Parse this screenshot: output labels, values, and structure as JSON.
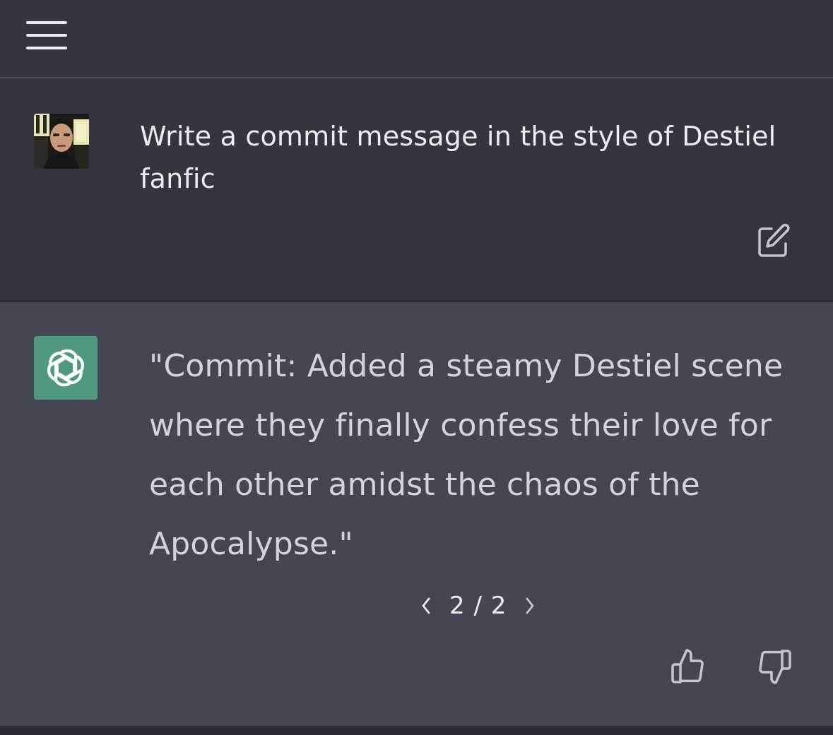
{
  "header": {
    "menu_icon": "hamburger-menu-icon"
  },
  "conversation": {
    "user_message": {
      "avatar": "user-avatar-photo",
      "text": "Write a commit message in the style of Destiel fanfic",
      "edit_icon": "edit-icon"
    },
    "assistant_message": {
      "avatar": "openai-logo-icon",
      "avatar_color": "#4f9a7e",
      "text": "\"Commit: Added a steamy Destiel scene where they finally confess their love for each other amidst the chaos of the Apocalypse.\"",
      "pager": {
        "prev_icon": "chevron-left-icon",
        "label": "2 / 2",
        "next_icon": "chevron-right-icon"
      },
      "thumbs_up_icon": "thumbs-up-icon",
      "thumbs_down_icon": "thumbs-down-icon"
    }
  },
  "colors": {
    "background": "#343541",
    "assistant_background": "#444654",
    "text": "#ececf1"
  }
}
